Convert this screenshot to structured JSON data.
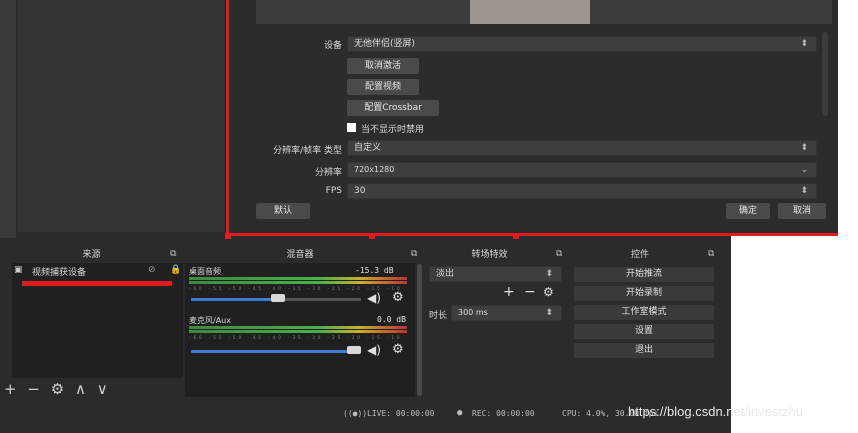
{
  "properties": {
    "device_label": "设备",
    "device_value": "无他伴侣(竖屏)",
    "deactivate_button": "取消激活",
    "configure_video_button": "配置视频",
    "configure_crossbar_button": "配置Crossbar",
    "hide_checkbox_label": "当不显示时禁用",
    "res_type_label": "分辨率/帧率 类型",
    "res_type_value": "自定义",
    "resolution_label": "分辨率",
    "resolution_value": "720x1280",
    "fps_label": "FPS",
    "fps_value": "30",
    "defaults_button": "默认",
    "ok_button": "确定",
    "cancel_button": "取消"
  },
  "sources": {
    "title": "来源",
    "items": [
      {
        "label": "视频捕获设备"
      }
    ],
    "toolbar": {
      "add": "+",
      "remove": "−",
      "settings": "⚙",
      "up": "∧",
      "down": "∨"
    }
  },
  "mixer": {
    "title": "混音器",
    "channels": [
      {
        "name": "桌面音频",
        "level": "-15.3 dB",
        "volume": 0.55
      },
      {
        "name": "麦克风/Aux",
        "level": "0.0 dB",
        "volume": 1.0
      }
    ],
    "ticks": "-60 -55 -50 -45 -40 -35 -30 -25 -20 -15 -10 -5 0"
  },
  "transitions": {
    "title": "转场特效",
    "selected": "淡出",
    "duration_label": "时长",
    "duration_value": "300 ms",
    "add": "+",
    "remove": "−",
    "settings": "⚙"
  },
  "controls": {
    "title": "控件",
    "buttons": [
      "开始推流",
      "开始录制",
      "工作室模式",
      "设置",
      "退出"
    ]
  },
  "status": {
    "live": "LIVE: 00:00:00",
    "rec": "REC: 00:00:00",
    "cpu": "CPU: 4.0%, 30.00 fps"
  },
  "watermark": "https://blog.csdn.net/investzhu"
}
